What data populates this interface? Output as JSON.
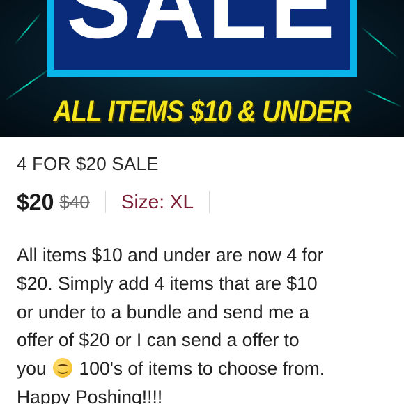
{
  "banner": {
    "headline": "SALE",
    "subline": "ALL ITEMS $10 & UNDER",
    "colors": {
      "background": "#061a26",
      "box_fill": "#0a2b7a",
      "box_border": "#0bb4e8",
      "headline": "#ffffff",
      "subline": "#f4e51c"
    }
  },
  "listing": {
    "title": "4 FOR $20 SALE",
    "price": "$20",
    "original_price": "$40",
    "size": "Size: XL",
    "description": {
      "lines": [
        "All items $10 and under are now 4 for",
        "$20.  Simply add 4 items that are $10",
        "or under to a bundle and send me a",
        "offer of $20 or I can send a offer to",
        "you",
        "100's of items to choose from.",
        "Happy Poshing!!!!"
      ],
      "emoji_icon": "smiling-face-emoji"
    }
  }
}
